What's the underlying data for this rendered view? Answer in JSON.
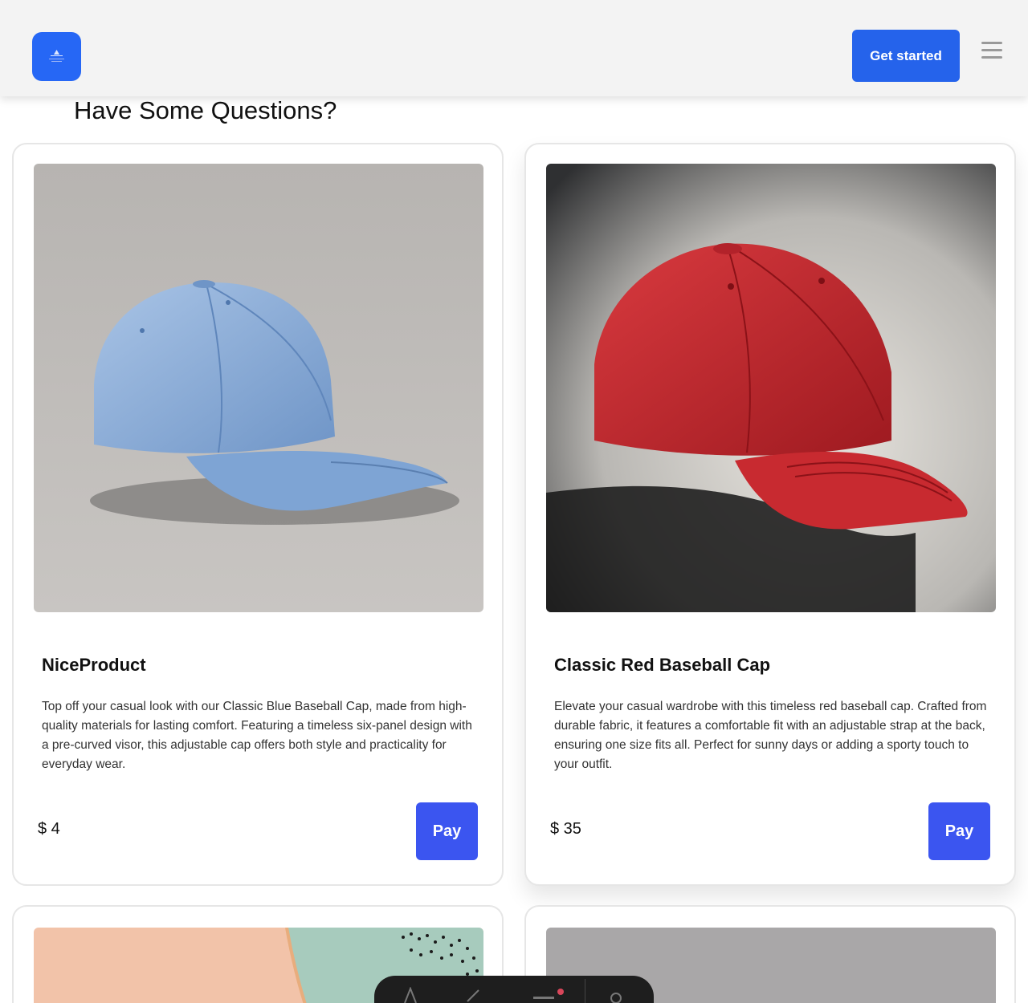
{
  "header": {
    "cta_label": "Get started",
    "logo_icon": "logo-icon",
    "menu_icon": "hamburger-menu-icon",
    "brand_color": "#2563eb"
  },
  "section": {
    "title": "Have Some Questions?"
  },
  "products": [
    {
      "name": "NiceProduct",
      "description": "Top off your casual look with our Classic Blue Baseball Cap, made from high-quality materials for lasting comfort. Featuring a timeless six-panel design with a pre-curved visor, this adjustable cap offers both style and practicality for everyday wear.",
      "price": "$ 4",
      "button_label": "Pay",
      "image": "blue-baseball-cap-photo"
    },
    {
      "name": "Classic Red Baseball Cap",
      "description": "Elevate your casual wardrobe with this timeless red baseball cap. Crafted from durable fabric, it features a comfortable fit with an adjustable strap at the back, ensuring one size fits all. Perfect for sunny days or adding a sporty touch to your outfit.",
      "price": "$ 35",
      "button_label": "Pay",
      "image": "red-baseball-cap-photo"
    }
  ],
  "colors": {
    "pay_button": "#3b55f0",
    "card_border": "#e6e6e6"
  }
}
